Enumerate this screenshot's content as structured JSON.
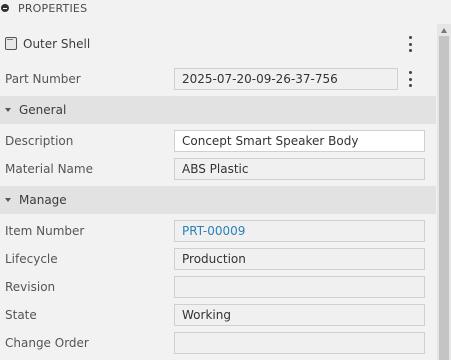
{
  "panel": {
    "title": "PROPERTIES"
  },
  "body": {
    "name": "Outer Shell",
    "icon": "body-icon"
  },
  "part_number": {
    "label": "Part Number",
    "value": "2025-07-20-09-26-37-756"
  },
  "general": {
    "title": "General",
    "description": {
      "label": "Description",
      "value": "Concept Smart Speaker Body"
    },
    "material": {
      "label": "Material Name",
      "value": "ABS Plastic"
    }
  },
  "manage": {
    "title": "Manage",
    "item_number": {
      "label": "Item Number",
      "value": "PRT-00009"
    },
    "lifecycle": {
      "label": "Lifecycle",
      "value": "Production"
    },
    "revision": {
      "label": "Revision",
      "value": ""
    },
    "state": {
      "label": "State",
      "value": "Working"
    },
    "change_order": {
      "label": "Change Order",
      "value": ""
    }
  },
  "colors": {
    "link": "#2a80b9",
    "section_bg": "#e2e2e2",
    "panel_bg": "#f2f2f2"
  }
}
